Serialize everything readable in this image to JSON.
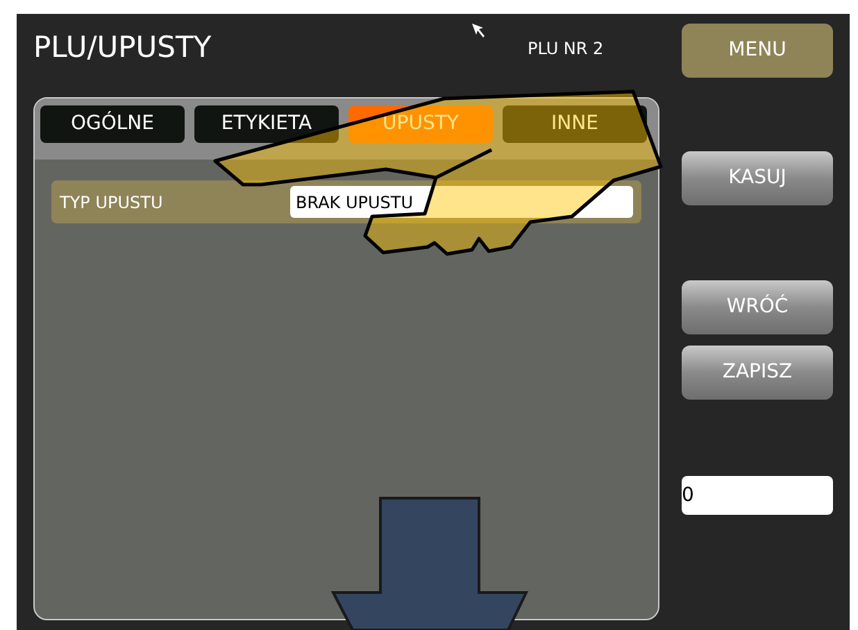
{
  "header": {
    "title": "PLU/UPUSTY",
    "plu_number": "PLU NR 2"
  },
  "menu_button": "MENU",
  "tabs": [
    {
      "label": "OGÓLNE",
      "selected": false
    },
    {
      "label": "ETYKIETA",
      "selected": false
    },
    {
      "label": "UPUSTY",
      "selected": true
    },
    {
      "label": "INNE",
      "selected": false
    }
  ],
  "fields": [
    {
      "label": "TYP UPUSTU",
      "value": "BRAK UPUSTU"
    }
  ],
  "side_buttons": [
    {
      "label": "KASUJ"
    },
    {
      "label": "WRÓĆ"
    },
    {
      "label": "ZAPISZ"
    }
  ],
  "number_input": {
    "value": "0"
  }
}
